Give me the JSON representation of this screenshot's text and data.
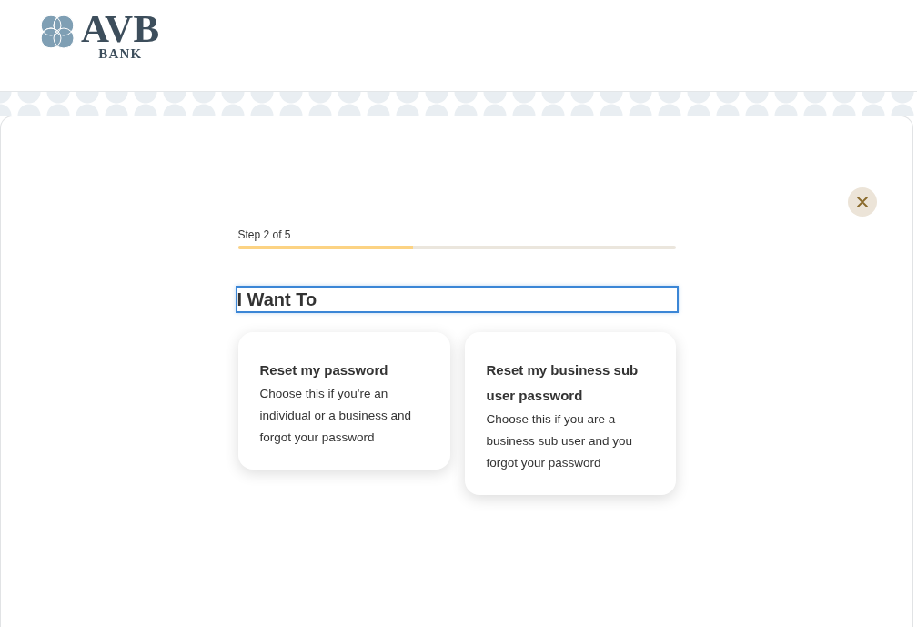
{
  "logo": {
    "wordmark": "AVB",
    "subtitle": "BANK"
  },
  "progress": {
    "label": "Step 2 of 5",
    "level": 0.4
  },
  "heading": {
    "text": "I Want To",
    "focused": true
  },
  "options": [
    {
      "title": "Reset my password",
      "description": "Choose this if you're an individual or a business and forgot your password"
    },
    {
      "title": "Reset my business sub user password",
      "description": "Choose this if you are a business sub user and you forgot your password"
    }
  ]
}
